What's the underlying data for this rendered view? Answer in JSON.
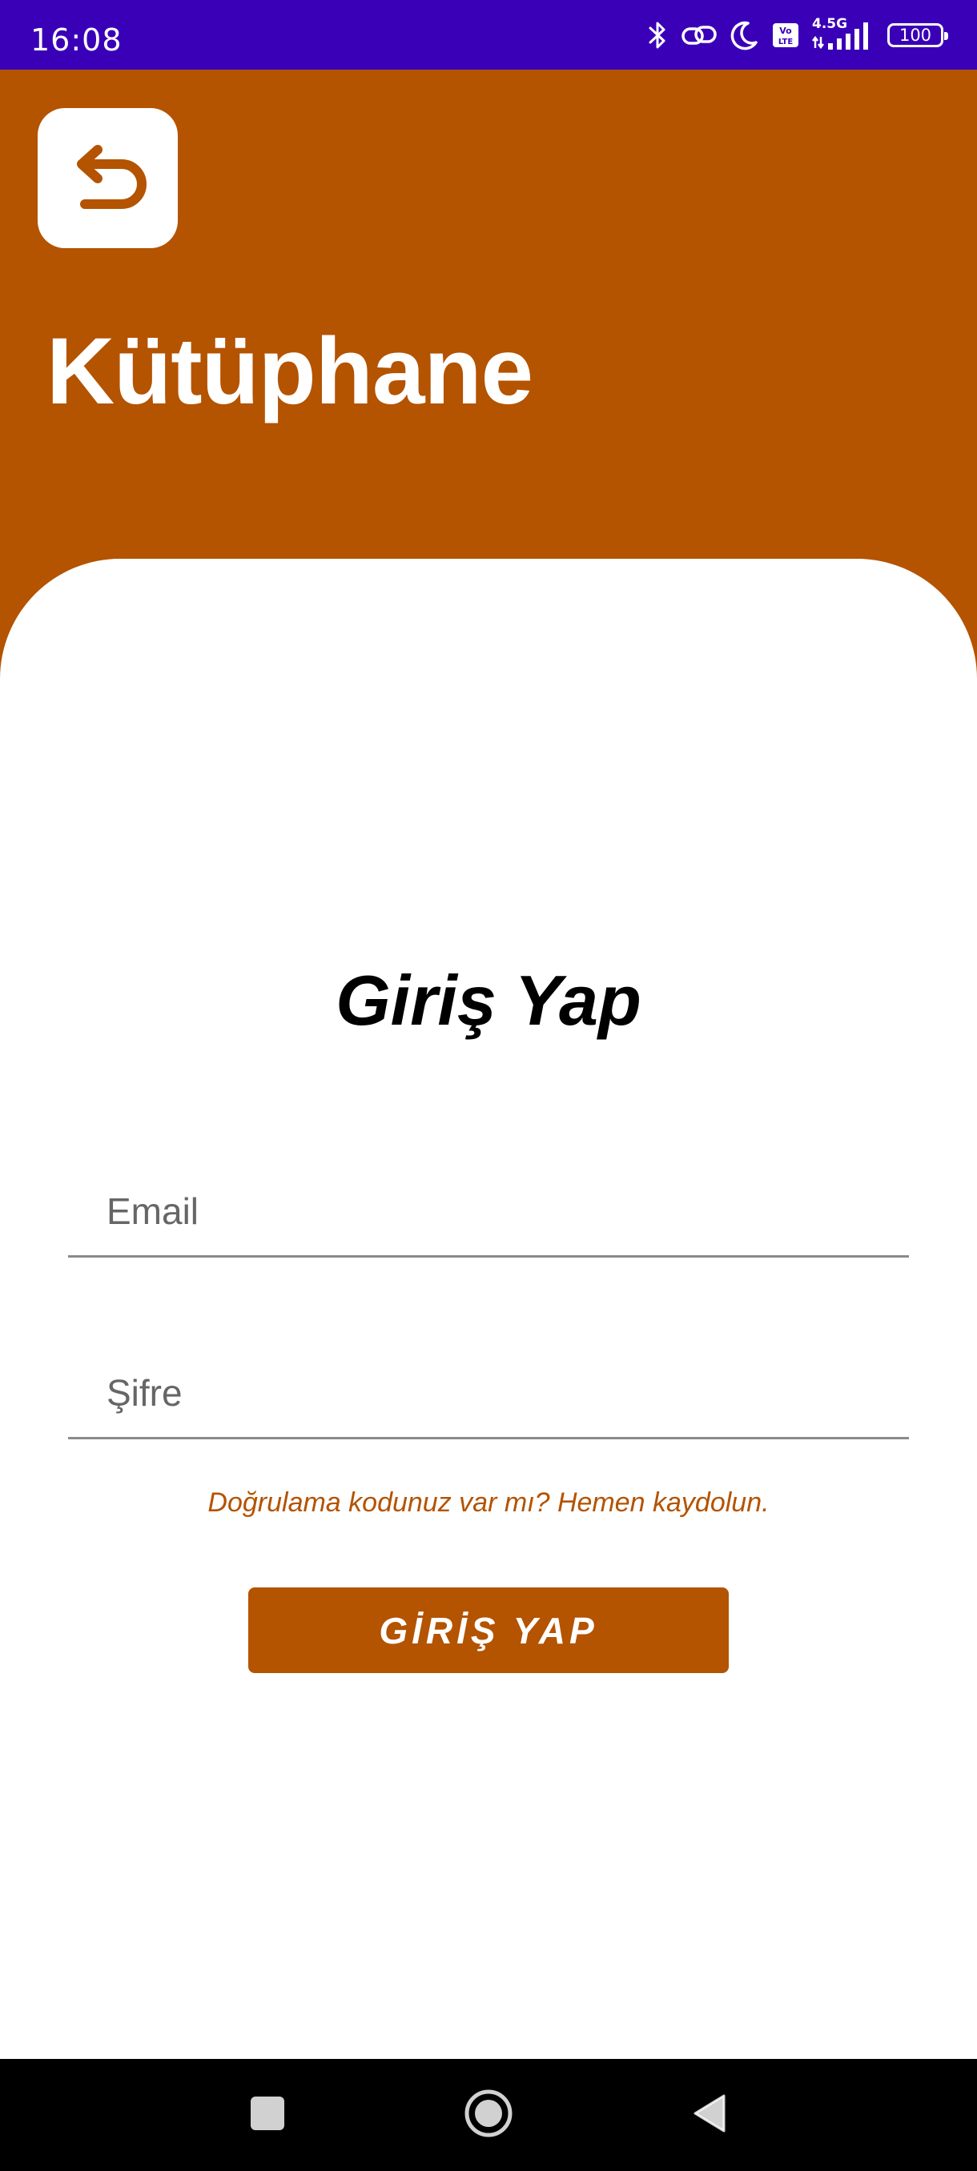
{
  "status_bar": {
    "time": "16:08",
    "network_label": "4.5G",
    "battery_level": "100",
    "icons": [
      "bluetooth-icon",
      "link-icon",
      "moon-icon",
      "volte-icon",
      "signal-icon",
      "battery-icon"
    ]
  },
  "header": {
    "title": "Kütüphane",
    "back_icon": "return-arrow-icon"
  },
  "form": {
    "title": "Giriş Yap",
    "email_placeholder": "Email",
    "email_value": "",
    "password_placeholder": "Şifre",
    "password_value": "",
    "register_link": "Doğrulama kodunuz var mı? Hemen kaydolun.",
    "submit_label": "GİRİŞ YAP"
  },
  "nav_bar": {
    "items": [
      "recents-square-icon",
      "home-circle-icon",
      "back-triangle-icon"
    ]
  },
  "colors": {
    "status_bar": "#3a00b8",
    "primary": "#b45300",
    "background": "#ffffff",
    "nav_bar": "#000000"
  }
}
